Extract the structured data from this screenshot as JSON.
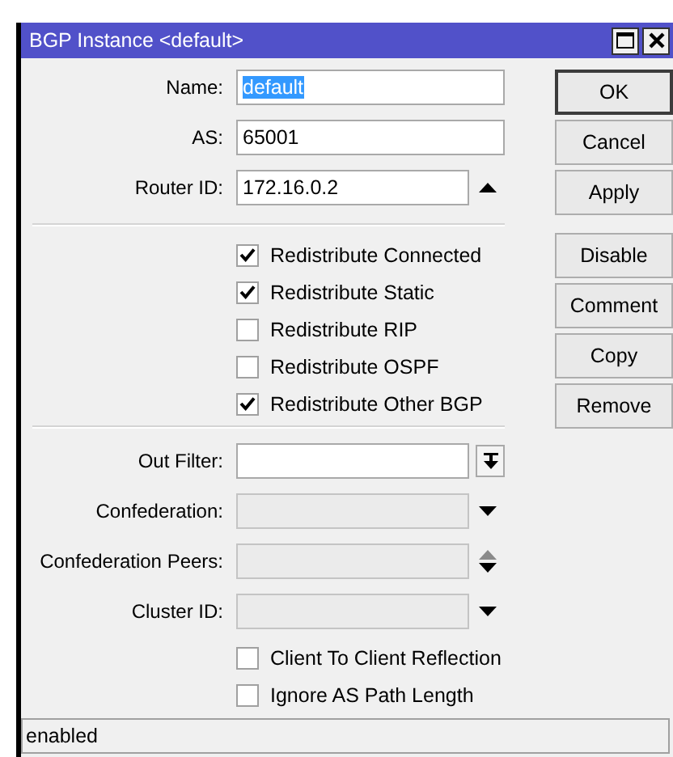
{
  "window": {
    "title": "BGP Instance <default>"
  },
  "general_fields": [
    {
      "kind": "text",
      "label": "Name:",
      "value": "default",
      "highlighted": true,
      "disabled": false
    },
    {
      "kind": "text",
      "label": "AS:",
      "value": "65001",
      "highlighted": false,
      "disabled": false
    },
    {
      "kind": "collapse",
      "label": "Router ID:",
      "value": "172.16.0.2",
      "highlighted": false,
      "disabled": false
    }
  ],
  "redistribute": [
    {
      "label": "Redistribute Connected",
      "checked": true
    },
    {
      "label": "Redistribute Static",
      "checked": true
    },
    {
      "label": "Redistribute RIP",
      "checked": false
    },
    {
      "label": "Redistribute OSPF",
      "checked": false
    },
    {
      "label": "Redistribute Other BGP",
      "checked": true
    }
  ],
  "filter_fields": [
    {
      "kind": "list-button",
      "label": "Out Filter:",
      "disabled": false
    },
    {
      "kind": "dropdown",
      "label": "Confederation:",
      "disabled": true
    },
    {
      "kind": "updown",
      "label": "Confederation Peers:",
      "disabled": true
    },
    {
      "kind": "dropdown",
      "label": "Cluster ID:",
      "disabled": true
    }
  ],
  "options": [
    {
      "label": "Client To Client Reflection",
      "checked": false
    },
    {
      "label": "Ignore AS Path Length",
      "checked": false
    }
  ],
  "dialog_buttons": [
    {
      "label": "OK",
      "default": true
    },
    {
      "label": "Cancel",
      "default": false
    },
    {
      "label": "Apply",
      "default": false
    }
  ],
  "action_buttons": [
    {
      "label": "Disable",
      "default": false
    },
    {
      "label": "Comment",
      "default": false
    },
    {
      "label": "Copy",
      "default": false
    },
    {
      "label": "Remove",
      "default": false
    }
  ],
  "status_bar": {
    "text": "enabled"
  }
}
